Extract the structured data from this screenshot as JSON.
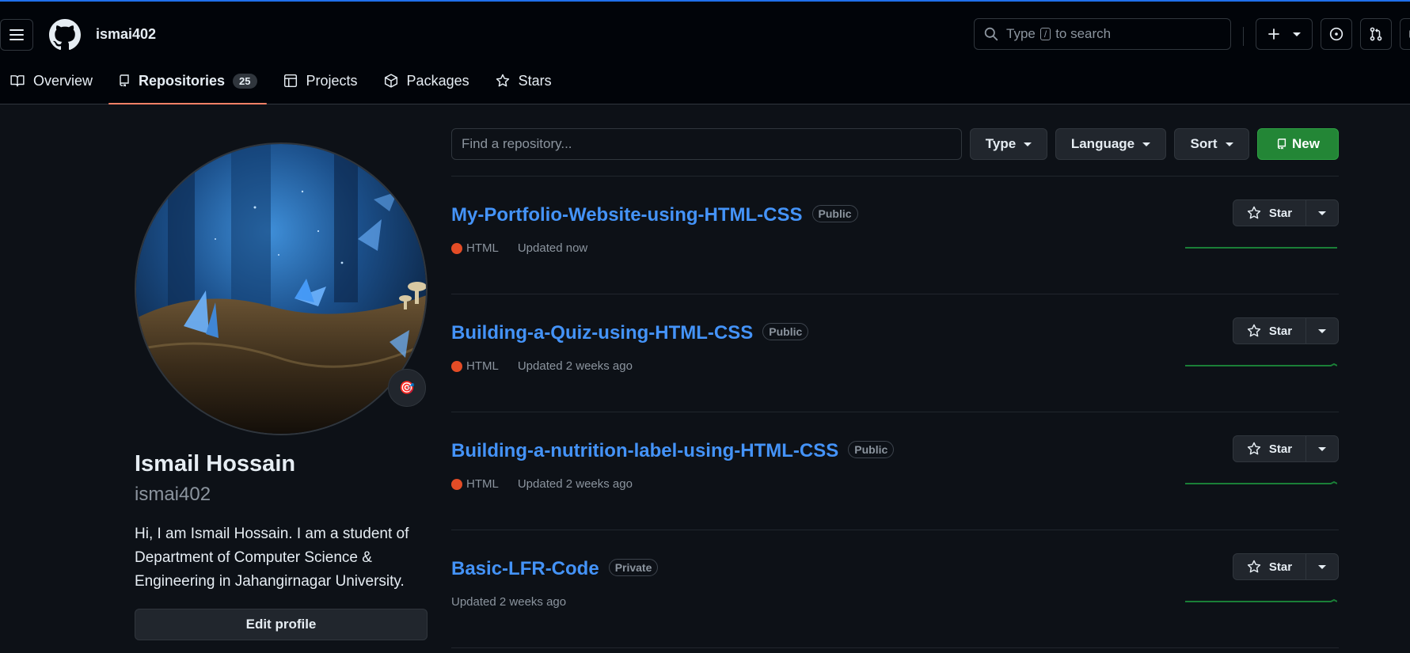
{
  "header": {
    "username": "ismai402",
    "search_prefix": "Type",
    "search_key": "/",
    "search_suffix": "to search"
  },
  "tabs": [
    {
      "label": "Overview",
      "icon": "book-icon"
    },
    {
      "label": "Repositories",
      "icon": "repo-icon",
      "count": "25",
      "active": true
    },
    {
      "label": "Projects",
      "icon": "table-icon"
    },
    {
      "label": "Packages",
      "icon": "package-icon"
    },
    {
      "label": "Stars",
      "icon": "star-icon"
    }
  ],
  "profile": {
    "full_name": "Ismail Hossain",
    "login": "ismai402",
    "bio": "Hi, I am Ismail Hossain. I am a student of Department of Computer Science & Engineering in Jahangirnagar University.",
    "edit_label": "Edit profile",
    "status_emoji": "🎯"
  },
  "filters": {
    "find_placeholder": "Find a repository...",
    "type_label": "Type",
    "language_label": "Language",
    "sort_label": "Sort",
    "new_label": "New"
  },
  "repos": [
    {
      "name": "My-Portfolio-Website-using-HTML-CSS",
      "visibility": "Public",
      "language": "HTML",
      "updated": "Updated now",
      "star_label": "Star"
    },
    {
      "name": "Building-a-Quiz-using-HTML-CSS",
      "visibility": "Public",
      "language": "HTML",
      "updated": "Updated 2 weeks ago",
      "star_label": "Star"
    },
    {
      "name": "Building-a-nutrition-label-using-HTML-CSS",
      "visibility": "Public",
      "language": "HTML",
      "updated": "Updated 2 weeks ago",
      "star_label": "Star"
    },
    {
      "name": "Basic-LFR-Code",
      "visibility": "Private",
      "language": "",
      "updated": "Updated 2 weeks ago",
      "star_label": "Star"
    }
  ],
  "colors": {
    "accent": "#1f6feb",
    "link": "#4493f8",
    "new_button": "#238636",
    "html_language": "#e34c26",
    "tab_underline": "#f78166",
    "sparkline": "#1a7f37"
  }
}
